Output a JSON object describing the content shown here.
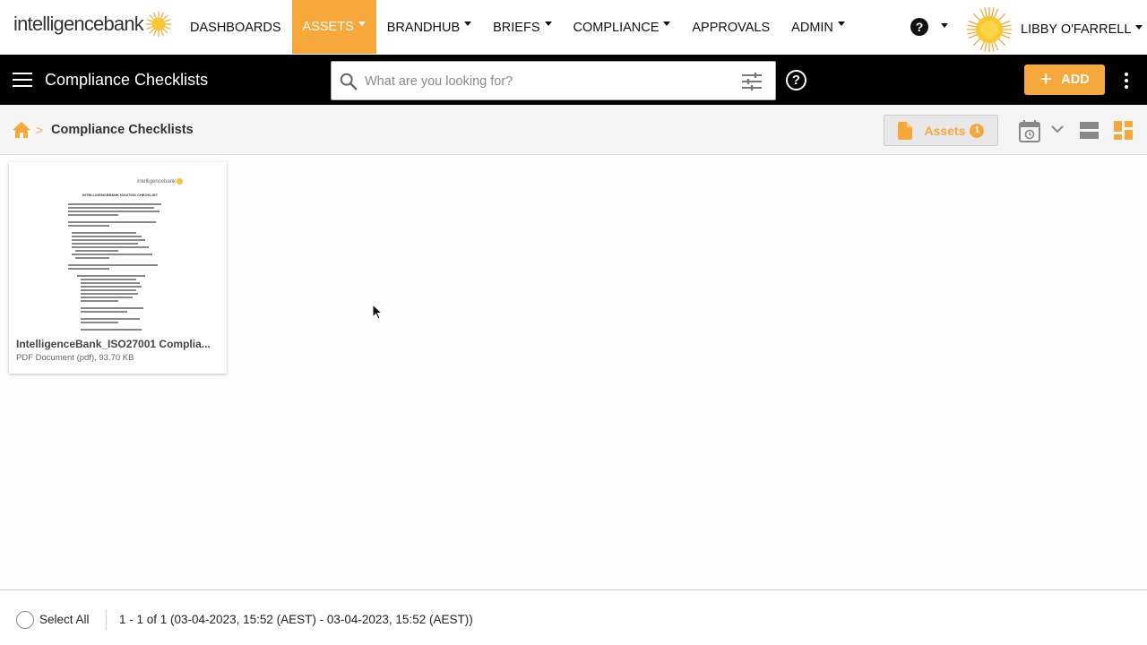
{
  "brand": {
    "logo_text": "intelligencebank",
    "accent": "#f7a83b"
  },
  "topnav": {
    "items": [
      {
        "label": "DASHBOARDS",
        "caret": false
      },
      {
        "label": "ASSETS",
        "caret": true,
        "active": true
      },
      {
        "label": "BRANDHUB",
        "caret": true
      },
      {
        "label": "BRIEFS",
        "caret": true
      },
      {
        "label": "COMPLIANCE",
        "caret": true
      },
      {
        "label": "APPROVALS",
        "caret": false
      },
      {
        "label": "ADMIN",
        "caret": true
      }
    ],
    "help_symbol": "?",
    "user_name": "LIBBY O'FARRELL"
  },
  "toolbar": {
    "title": "Compliance Checklists",
    "search_placeholder": "What are you looking for?",
    "help_symbol": "?",
    "add_plus": "+",
    "add_label": "ADD"
  },
  "breadcrumb": {
    "separator": ">",
    "current": "Compliance Checklists",
    "assets_label": "Assets",
    "assets_count": "1"
  },
  "card": {
    "thumb_logo": "intelligencebank",
    "thumb_heading": "INTELLIGENCEBANK ISO27001 CHECKLIST",
    "title": "IntelligenceBank_ISO27001 Complia...",
    "meta": "PDF Document (pdf), 93.70 KB"
  },
  "footer": {
    "select_all": "Select All",
    "pager": "1 - 1 of 1 (03-04-2023, 15:52 (AEST) - 03-04-2023, 15:52 (AEST))"
  }
}
